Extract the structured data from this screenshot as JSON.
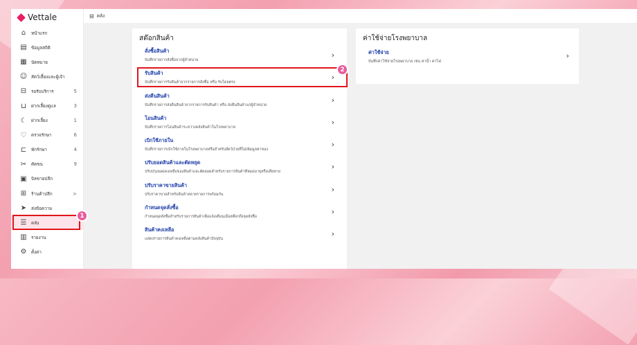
{
  "brand": {
    "name": "Vettale",
    "color": "#e91e63"
  },
  "sidebar": {
    "items": [
      {
        "icon": "home-icon",
        "glyph": "⌂",
        "label": "หน้าแรก",
        "count": ""
      },
      {
        "icon": "stats-icon",
        "glyph": "▤",
        "label": "ข้อมูลสถิติ",
        "count": ""
      },
      {
        "icon": "calendar-icon",
        "glyph": "▦",
        "label": "นัดหมาย",
        "count": ""
      },
      {
        "icon": "pets-owner-icon",
        "glyph": "☺",
        "label": "สัตว์เลี้ยงและผู้เจ้า",
        "count": ""
      },
      {
        "icon": "queue-icon",
        "glyph": "⊟",
        "label": "รอรับบริการ",
        "count": "5"
      },
      {
        "icon": "bed-icon",
        "glyph": "⊔",
        "label": "ฝากเลี้ยงดูแล",
        "count": "3"
      },
      {
        "icon": "moon-icon",
        "glyph": "☾",
        "label": "ฝากเลี้ยง",
        "count": "1"
      },
      {
        "icon": "stethoscope-icon",
        "glyph": "♡",
        "label": "ตรวจรักษา",
        "count": "6"
      },
      {
        "icon": "ward-icon",
        "glyph": "⊏",
        "label": "พักรักษา",
        "count": "4"
      },
      {
        "icon": "grooming-icon",
        "glyph": "✂",
        "label": "ตัดขน",
        "count": "9"
      },
      {
        "icon": "invoice-icon",
        "glyph": "▣",
        "label": "บิลขายปลีก",
        "count": ""
      },
      {
        "icon": "shop-icon",
        "glyph": "⊞",
        "label": "ร้านค้าปลีก",
        "count": ">"
      },
      {
        "icon": "send-icon",
        "glyph": "➤",
        "label": "ส่งข้อความ",
        "count": ""
      },
      {
        "icon": "inventory-icon",
        "glyph": "☰",
        "label": "คลัง",
        "count": "",
        "active": true
      },
      {
        "icon": "report-icon",
        "glyph": "▥",
        "label": "รายงาน",
        "count": ""
      },
      {
        "icon": "settings-icon",
        "glyph": "⚙",
        "label": "ตั้งค่า",
        "count": ""
      }
    ]
  },
  "topbar": {
    "icon": "inventory-icon",
    "glyph": "⊟",
    "title": "คลัง"
  },
  "stock_panel": {
    "title": "สต๊อกสินค้า",
    "items": [
      {
        "title": "สั่งซื้อสินค้า",
        "desc": "บันทึกรายการสั่งซื้อจากผู้จำหน่าย"
      },
      {
        "title": "รับสินค้า",
        "desc": "บันทึกรายการรับสินค้าจากรายการสั่งซื้อ หรือ รับโดยตรง",
        "highlight": true
      },
      {
        "title": "ส่งคืนสินค้า",
        "desc": "บันทึกรายการส่งคืนสินค้าจากรายการรับสินค้า หรือ ส่งคืนสินค้าแก่ผู้จำหน่าย"
      },
      {
        "title": "โอนสินค้า",
        "desc": "บันทึกรายการโอนสินค้าระหว่างคลังสินค้าในโรงพยาบาล"
      },
      {
        "title": "เบิกใช้ภายใน",
        "desc": "บันทึกรายการเบิกใช้ภายในโรงพยาบาลหรือสำหรับสัตว์ป่วยที่ไม่เพิ่มมูลค่าของ"
      },
      {
        "title": "ปรับยอดสินค้าและตัดหยุด",
        "desc": "ปรับปรุงยอดคงเหลือของสินค้าและตัดยอดสำหรับรายการสินค้าที่หมดอายุหรือเสียหาย"
      },
      {
        "title": "ปรับราคาขายสินค้า",
        "desc": "ปรับราคาขายสำหรับสินค้าหลายรายการพร้อมกัน"
      },
      {
        "title": "กำหนดจุดสั่งซื้อ",
        "desc": "กำหนดจุดสั่งซื้อสำหรับรายการสินค้าเพื่อแจ้งเตือนเมื่อสต๊อกถึงจุดสั่งซื้อ"
      },
      {
        "title": "สินค้าคงเหลือ",
        "desc": "แสดงรายการสินค้าคงเหลือตามคลังสินค้าปัจจุบัน"
      }
    ]
  },
  "expense_panel": {
    "title": "ค่าใช้จ่ายโรงพยาบาล",
    "items": [
      {
        "title": "ค่าใช้จ่าย",
        "desc": "บันทึกค่าใช้จ่ายโรงพยาบาล เช่น ค่าน้ำ ค่าไฟ"
      }
    ]
  },
  "annotations": {
    "badge_1": "1",
    "badge_2": "2",
    "badge_color": "#e95b9c",
    "box_color": "#e0141c"
  }
}
